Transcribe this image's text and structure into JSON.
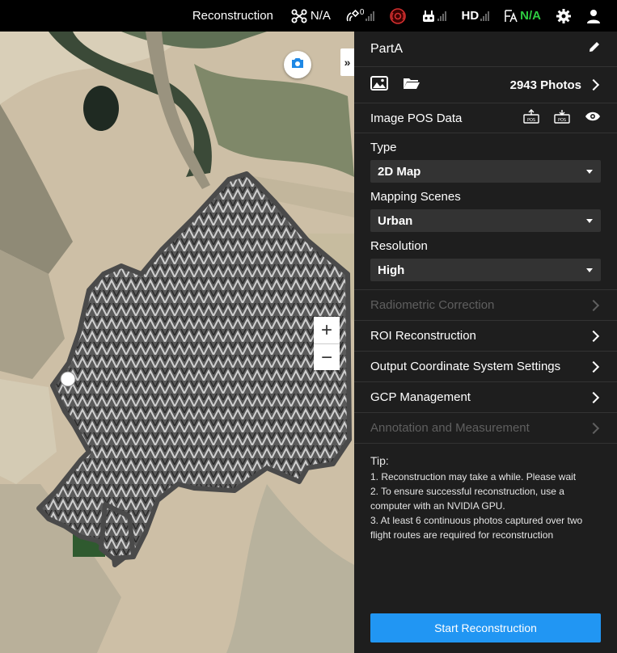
{
  "topbar": {
    "mode": "Reconstruction",
    "drone_status": "N/A",
    "rtk_sat_count": "0",
    "video_label": "HD",
    "rtk_status": "N/A"
  },
  "panel": {
    "project_name": "PartA",
    "photo_count": "2943 Photos",
    "pos_label": "Image POS Data",
    "type_label": "Type",
    "type_value": "2D Map",
    "scenes_label": "Mapping Scenes",
    "scenes_value": "Urban",
    "resolution_label": "Resolution",
    "resolution_value": "High",
    "menu": [
      {
        "label": "Radiometric Correction",
        "enabled": false
      },
      {
        "label": "ROI Reconstruction",
        "enabled": true
      },
      {
        "label": "Output Coordinate System Settings",
        "enabled": true
      },
      {
        "label": "GCP Management",
        "enabled": true
      },
      {
        "label": "Annotation and Measurement",
        "enabled": false
      }
    ],
    "tip_title": "Tip:",
    "tips": [
      "1. Reconstruction may take a while. Please wait",
      "2. To ensure successful reconstruction, use a computer with an NVIDIA GPU.",
      "3. At least 6 continuous photos captured over two flight routes are required for reconstruction"
    ],
    "start_button": "Start Reconstruction"
  },
  "map": {
    "zoom_in": "+",
    "zoom_out": "−",
    "collapse_glyph": "»"
  },
  "colors": {
    "accent": "#2196f3",
    "panel_bg": "#1e1e1e",
    "status_ok": "#2ecc40",
    "disabled_text": "#5f5f5f"
  },
  "icons": [
    "drone-icon",
    "rtk-satellite-icon",
    "remote-status-icon",
    "controller-icon",
    "settings-gear-icon",
    "user-icon",
    "edit-pencil-icon",
    "image-icon",
    "folder-icon",
    "pos-import-icon",
    "pos-export-icon",
    "eye-icon",
    "camera-icon"
  ]
}
